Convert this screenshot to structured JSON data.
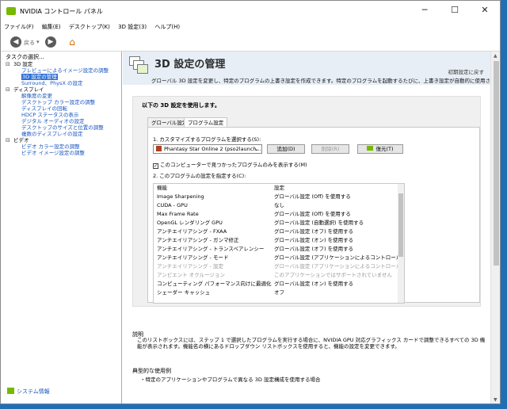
{
  "window": {
    "title": "NVIDIA コントロール パネル",
    "controls": {
      "minimize": "─",
      "maximize": "☐",
      "close": "✕"
    }
  },
  "menu": [
    "ファイル(F)",
    "編集(E)",
    "デスクトップ(K)",
    "3D 設定(3)",
    "ヘルプ(H)"
  ],
  "toolbar": {
    "back_label": "戻る",
    "back_arrow": "◀",
    "forward_arrow": "▶",
    "dropdown": "▾",
    "home_icon": "⌂"
  },
  "sidebar": {
    "header": "タスクの選択...",
    "tree": [
      {
        "type": "cat",
        "label": "3D 設定"
      },
      {
        "type": "item",
        "label": "プレビューによるイメージ設定の調整"
      },
      {
        "type": "item",
        "label": "3D 設定の管理",
        "selected": true
      },
      {
        "type": "item",
        "label": "Surround、PhysX の設定"
      },
      {
        "type": "cat",
        "label": "ディスプレイ"
      },
      {
        "type": "item",
        "label": "解像度の変更"
      },
      {
        "type": "item",
        "label": "デスクトップ カラー設定の調整"
      },
      {
        "type": "item",
        "label": "ディスプレイの回転"
      },
      {
        "type": "item",
        "label": "HDCP ステータスの表示"
      },
      {
        "type": "item",
        "label": "デジタル オーディオの設定"
      },
      {
        "type": "item",
        "label": "デスクトップのサイズと位置の調整"
      },
      {
        "type": "item",
        "label": "複数のディスプレイの設定"
      },
      {
        "type": "cat",
        "label": "ビデオ"
      },
      {
        "type": "item",
        "label": "ビデオ カラー設定の調整"
      },
      {
        "type": "item",
        "label": "ビデオ イメージ設定の調整"
      }
    ],
    "system_info": "システム情報"
  },
  "main": {
    "title": "3D 設定の管理",
    "restore_default": "初期設定に戻す",
    "description": "グローバル 3D 設定を変更し、特定のプログラムの上書き設定を作成できます。特定のプログラムを起動するたびに、上書き設定が自動的に使用されます。",
    "panel_title": "以下の 3D 設定を使用します。",
    "tabs": [
      "グローバル設定",
      "プログラム設定"
    ],
    "active_tab": 1,
    "step1_label": "1. カスタマイズするプログラムを選択する(S):",
    "program_selected": "Phantasy Star Online 2 (pso2launch...",
    "add_button": "追加(D)",
    "remove_button": "削除(R)",
    "restore_button": "復元(T)",
    "show_only_found_label": "このコンピューターで見つかったプログラムのみを表示する(M)",
    "show_only_found_checked": true,
    "step2_label": "2. このプログラムの設定を指定する(C):",
    "settings_table": {
      "headers": [
        "機能",
        "設定"
      ],
      "rows": [
        {
          "feature": "Image Sharpening",
          "value": "グローバル設定 (Off) を使用する",
          "dim": false
        },
        {
          "feature": "CUDA - GPU",
          "value": "なし",
          "dim": false
        },
        {
          "feature": "Max Frame Rate",
          "value": "グローバル設定 (Off) を使用する",
          "dim": false
        },
        {
          "feature": "OpenGL レンダリング GPU",
          "value": "グローバル設定 (自動選択) を使用する",
          "dim": false
        },
        {
          "feature": "アンチエイリアシング - FXAA",
          "value": "グローバル設定 (オフ) を使用する",
          "dim": false
        },
        {
          "feature": "アンチエイリアシング - ガンマ修正",
          "value": "グローバル設定 (オン) を使用する",
          "dim": false
        },
        {
          "feature": "アンチエイリアシング - トランスペアレンシー",
          "value": "グローバル設定 (オフ) を使用する",
          "dim": false
        },
        {
          "feature": "アンチエイリアシング - モード",
          "value": "グローバル設定 (アプリケーションによるコントロール) を...",
          "dim": false
        },
        {
          "feature": "アンチエイリアシング - 設定",
          "value": "グローバル設定 (アプリケーションによるコントロール) を...",
          "dim": true
        },
        {
          "feature": "アンビエント オクルージョン",
          "value": "このアプリケーションではサポートされていません",
          "dim": true
        },
        {
          "feature": "コンピューティング パフォーマンス向けに最適化",
          "value": "グローバル設定 (オン) を使用する",
          "dim": false
        },
        {
          "feature": "シェーダー キャッシュ",
          "value": "オフ",
          "dim": false
        }
      ]
    },
    "description_title": "説明",
    "description_text": "このリストボックスには、ステップ 1 で選択したプログラムを実行する場合に、NVIDIA GPU 対応グラフィックス カードで調整できるすべての 3D 機能が表示されます。機能名の横にあるドロップダウン リストボックスを使用すると、機能の設定を変更できます。",
    "typical_title": "典型的な使用例",
    "typical_items": [
      "特定のアプリケーションやプログラムで異なる 3D 設定構成を使用する場合"
    ]
  },
  "colors": {
    "accent": "#2d6fd6",
    "nvidia_green": "#76b900",
    "link": "#1a56c0",
    "banner_bg": "#e8eef6"
  }
}
